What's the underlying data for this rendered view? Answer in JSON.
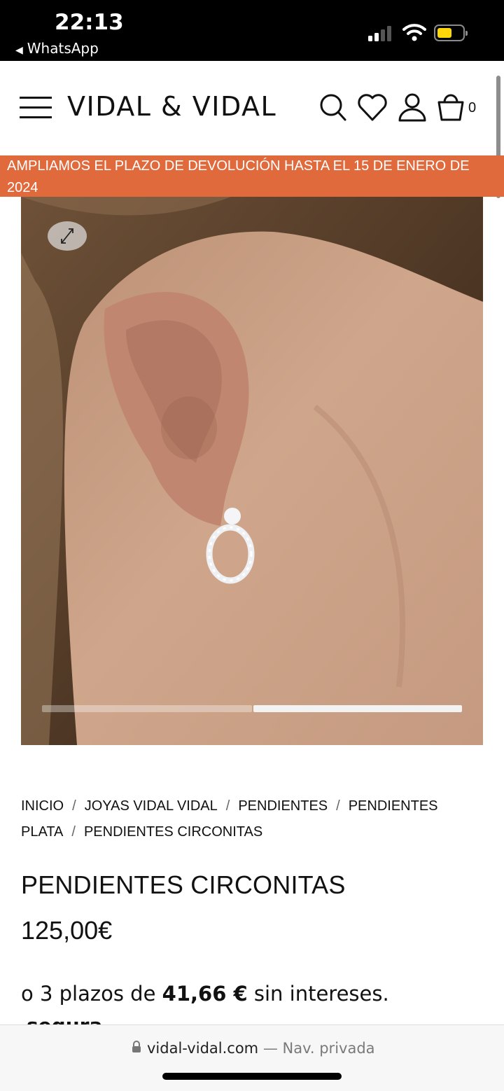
{
  "status_bar": {
    "time": "22:13",
    "back_app": "WhatsApp",
    "back_icon": "back-triangle-icon"
  },
  "header": {
    "logo": "VIDAL & VIDAL",
    "cart_count": "0",
    "icons": [
      "menu-icon",
      "search-icon",
      "heart-icon",
      "user-icon",
      "cart-icon"
    ]
  },
  "promo": {
    "text": "AMPLIAMOS EL PLAZO DE DEVOLUCIÓN HASTA EL 15 DE ENERO DE 2024"
  },
  "gallery": {
    "slide_count": 2,
    "active_slide": 2
  },
  "breadcrumb": [
    "INICIO",
    "JOYAS VIDAL VIDAL",
    "PENDIENTES",
    "PENDIENTES PLATA",
    "PENDIENTES CIRCONITAS"
  ],
  "product": {
    "title": "PENDIENTES CIRCONITAS",
    "price": "125,00€",
    "installments_prefix": "o 3 plazos de",
    "installments_amount": "41,66 €",
    "installments_suffix": "sin intereses.",
    "payment_brand": "sequra"
  },
  "browser": {
    "domain": "vidal-vidal.com",
    "mode": "— Nav. privada"
  },
  "colors": {
    "promo": "#e16a3d",
    "battery": "#ffd60a"
  }
}
